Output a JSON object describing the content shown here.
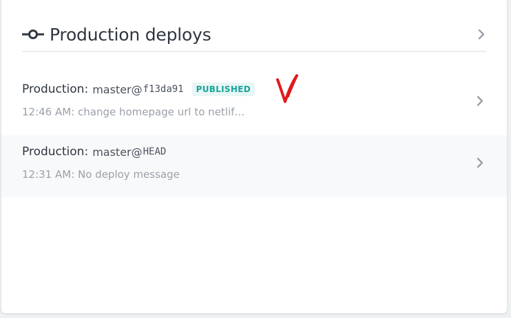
{
  "header": {
    "title": "Production deploys",
    "icon": "commit-icon",
    "chevron_icon": "chevron-right-icon"
  },
  "deploys": [
    {
      "environment": "Production",
      "separator": ":",
      "branch": "master",
      "at": "@",
      "ref": "f13da91",
      "badge": "PUBLISHED",
      "message": "12:46 AM: change homepage url to netlif…"
    },
    {
      "environment": "Production",
      "separator": ":",
      "branch": "master",
      "at": "@",
      "ref": "HEAD",
      "message": "12:31 AM: No deploy message"
    }
  ],
  "annotation": {
    "icon": "red-checkmark-icon",
    "color": "#e0191b"
  },
  "colors": {
    "published_badge_text": "#18a59a",
    "published_badge_bg": "#e8f6f5"
  }
}
